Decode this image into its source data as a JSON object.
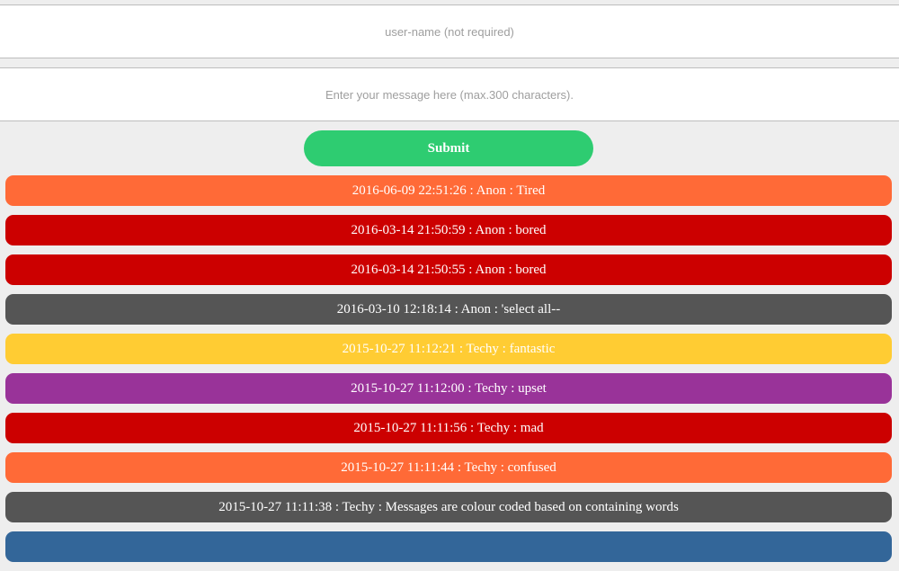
{
  "form": {
    "username_placeholder": "user-name (not required)",
    "message_placeholder": "Enter your message here (max.300 characters).",
    "submit_label": "Submit"
  },
  "messages": [
    {
      "text": "2016-06-09 22:51:26 : Anon : Tired",
      "color": "#ff6a37"
    },
    {
      "text": "2016-03-14 21:50:59 : Anon : bored",
      "color": "#cc0000"
    },
    {
      "text": "2016-03-14 21:50:55 : Anon : bored",
      "color": "#cc0000"
    },
    {
      "text": "2016-03-10 12:18:14 : Anon : 'select all--",
      "color": "#555555"
    },
    {
      "text": "2015-10-27 11:12:21 : Techy : fantastic",
      "color": "#ffcc33"
    },
    {
      "text": "2015-10-27 11:12:00 : Techy : upset",
      "color": "#993399"
    },
    {
      "text": "2015-10-27 11:11:56 : Techy : mad",
      "color": "#cc0000"
    },
    {
      "text": "2015-10-27 11:11:44 : Techy : confused",
      "color": "#ff6a37"
    },
    {
      "text": "2015-10-27 11:11:38 : Techy : Messages are colour coded based on containing words",
      "color": "#555555"
    },
    {
      "text": "",
      "color": "#336699"
    }
  ]
}
